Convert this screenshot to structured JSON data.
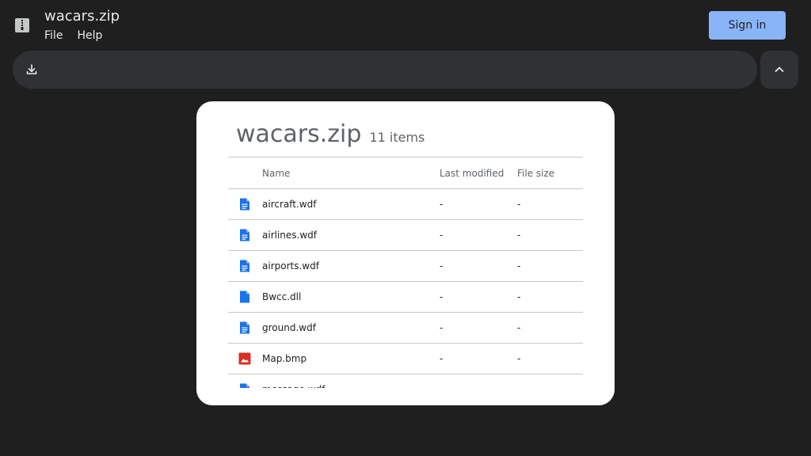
{
  "app": {
    "title": "wacars.zip",
    "menu": [
      "File",
      "Help"
    ],
    "sign_in_label": "Sign in",
    "accent": "#8ab4f8"
  },
  "toolbar": {
    "download_icon": "download-icon",
    "collapse_icon": "chevron-up-icon"
  },
  "archive": {
    "name": "wacars.zip",
    "item_count": "11 items",
    "columns": [
      "Name",
      "Last modified",
      "File size"
    ],
    "files": [
      {
        "icon": "document-icon",
        "name": "aircraft.wdf",
        "modified": "-",
        "size": "-"
      },
      {
        "icon": "document-icon",
        "name": "airlines.wdf",
        "modified": "-",
        "size": "-"
      },
      {
        "icon": "document-icon",
        "name": "airports.wdf",
        "modified": "-",
        "size": "-"
      },
      {
        "icon": "blank-file-icon",
        "name": "Bwcc.dll",
        "modified": "-",
        "size": "-"
      },
      {
        "icon": "document-icon",
        "name": "ground.wdf",
        "modified": "-",
        "size": "-"
      },
      {
        "icon": "image-icon",
        "name": "Map.bmp",
        "modified": "-",
        "size": "-"
      },
      {
        "icon": "document-icon",
        "name": "message.wdf",
        "modified": "-",
        "size": "-"
      }
    ]
  },
  "colors": {
    "file_icon_blue": "#1a73e8",
    "image_icon_red": "#d93025"
  }
}
